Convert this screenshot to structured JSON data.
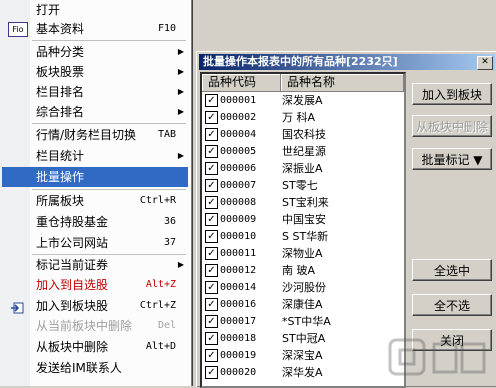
{
  "menu": {
    "items": [
      {
        "label": "打开"
      },
      {
        "label": "基本资料",
        "shortcut": "F10",
        "icon": "Fio"
      },
      {
        "label": "品种分类",
        "submenu": "▶"
      },
      {
        "label": "板块股票",
        "submenu": "▶"
      },
      {
        "label": "栏目排名",
        "submenu": "▶"
      },
      {
        "label": "综合排名",
        "submenu": "▶"
      },
      {
        "label": "行情/财务栏目切换",
        "shortcut": "TAB"
      },
      {
        "label": "栏目统计",
        "submenu": "▶"
      },
      {
        "label": "批量操作"
      },
      {
        "label": "所属板块",
        "shortcut": "Ctrl+R"
      },
      {
        "label": "重仓持股基金",
        "shortcut": "36"
      },
      {
        "label": "上市公司网站",
        "shortcut": "37"
      },
      {
        "label": "标记当前证券",
        "submenu": "▶"
      },
      {
        "label": "加入到自选股",
        "shortcut": "Alt+Z"
      },
      {
        "label": "加入到板块股",
        "shortcut": "Ctrl+Z"
      },
      {
        "label": "从当前板块中删除",
        "shortcut": "Del"
      },
      {
        "label": "从板块中删除",
        "shortcut": "Alt+D"
      },
      {
        "label": "发送给IM联系人"
      }
    ]
  },
  "dialog": {
    "title": "批量操作本报表中的所有品种[2232只]",
    "close": "✕",
    "columns": [
      "品种代码",
      "品种名称"
    ],
    "rows": [
      {
        "code": "000001",
        "name": "深发展A"
      },
      {
        "code": "000002",
        "name": "万  科A"
      },
      {
        "code": "000004",
        "name": "国农科技"
      },
      {
        "code": "000005",
        "name": "世纪星源"
      },
      {
        "code": "000006",
        "name": "深振业A"
      },
      {
        "code": "000007",
        "name": "ST零七"
      },
      {
        "code": "000008",
        "name": "ST宝利来"
      },
      {
        "code": "000009",
        "name": "中国宝安"
      },
      {
        "code": "000010",
        "name": "S ST华新"
      },
      {
        "code": "000011",
        "name": "深物业A"
      },
      {
        "code": "000012",
        "name": "南  玻A"
      },
      {
        "code": "000014",
        "name": "沙河股份"
      },
      {
        "code": "000016",
        "name": "深康佳A"
      },
      {
        "code": "000017",
        "name": "*ST中华A"
      },
      {
        "code": "000018",
        "name": "ST中冠A"
      },
      {
        "code": "000019",
        "name": "深深宝A"
      },
      {
        "code": "000020",
        "name": "深华发A"
      }
    ],
    "check": "✓",
    "buttons": {
      "add_block": "加入到板块",
      "remove_block": "从板块中删除",
      "batch_mark": "批量标记 ▼",
      "select_all": "全选中",
      "select_none": "全不选",
      "close": "关闭"
    }
  }
}
